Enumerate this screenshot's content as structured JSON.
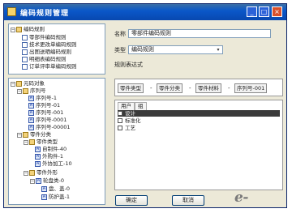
{
  "window": {
    "title": "编码规则管理"
  },
  "tree_top": {
    "root": "编码规则",
    "items": [
      "零部件编码规则",
      "技术更改单编码规则",
      "出图送晒编码规则",
      "明细表编码规则",
      "订单评审单编码规则"
    ]
  },
  "tree_bottom": {
    "root": "元码对象",
    "seq_group": "序列号",
    "seq_items": [
      "序列号-1",
      "序列号-01",
      "序列号-001",
      "序列号-0001",
      "序列号-00001"
    ],
    "part_cat": "零件分类",
    "part_type": "零件类型",
    "part_type_items": [
      "自制件-40",
      "外购件-1",
      "外协加工-10"
    ],
    "part_form": "零件外形",
    "part_form_sub": "轮盘类-0",
    "part_form_items": [
      "盘、盖-0",
      "防护盖-1"
    ]
  },
  "form": {
    "name_label": "名称",
    "name_value": "零部件编码规则",
    "category_label": "类型",
    "category_value": "编码规则",
    "expr_label": "规则表达式",
    "segments": [
      "零件类型",
      "零件分类",
      "零件材料",
      "序列号-001"
    ],
    "separator": "-"
  },
  "subpanel": {
    "tabs": [
      "用户",
      "组"
    ],
    "list": [
      "设计",
      "标准化",
      "工艺"
    ],
    "selected_index": 0
  },
  "buttons": {
    "ok": "确定",
    "cancel": "取消"
  },
  "logo": {
    "text": "e-works"
  }
}
